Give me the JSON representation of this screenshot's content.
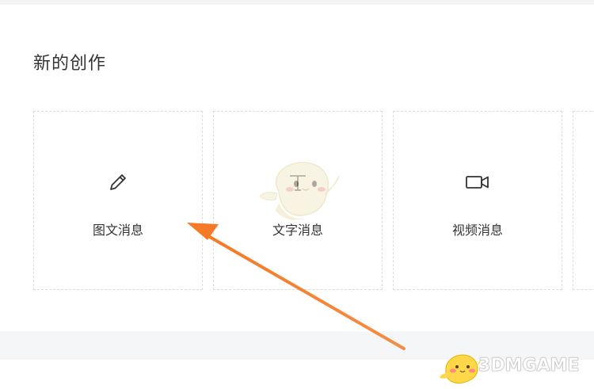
{
  "section": {
    "title": "新的创作"
  },
  "cards": [
    {
      "label": "图文消息",
      "icon": "pencil-icon"
    },
    {
      "label": "文字消息",
      "icon": "text-t-icon"
    },
    {
      "label": "视频消息",
      "icon": "video-camera-icon"
    }
  ],
  "annotation": {
    "arrow_color": "#f47a25",
    "arrow_target": "图文消息"
  },
  "watermark": {
    "text": "3DMGAME",
    "icon": "3dm-mascot-icon"
  }
}
